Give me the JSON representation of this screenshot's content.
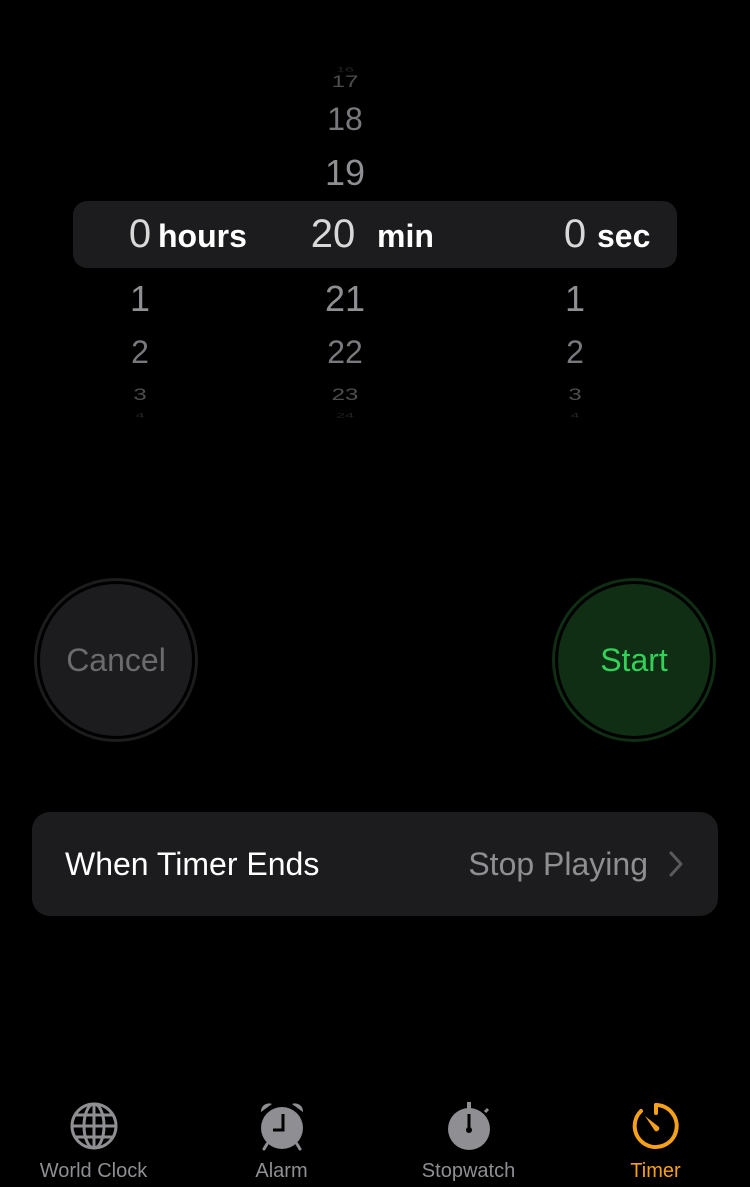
{
  "picker": {
    "hours": {
      "above": [],
      "selected": "0",
      "unit": "hours",
      "below": [
        "1",
        "2",
        "3",
        "4"
      ]
    },
    "minutes": {
      "above": [
        "16",
        "17",
        "18",
        "19"
      ],
      "selected": "20",
      "unit": "min",
      "below": [
        "21",
        "22",
        "23",
        "24"
      ]
    },
    "seconds": {
      "above": [],
      "selected": "0",
      "unit": "sec",
      "below": [
        "1",
        "2",
        "3",
        "4"
      ]
    }
  },
  "buttons": {
    "cancel_label": "Cancel",
    "start_label": "Start"
  },
  "timer_end": {
    "label": "When Timer Ends",
    "value": "Stop Playing"
  },
  "tabbar": {
    "items": [
      {
        "label": "World Clock",
        "icon": "globe-icon",
        "active": false
      },
      {
        "label": "Alarm",
        "icon": "alarm-clock-icon",
        "active": false
      },
      {
        "label": "Stopwatch",
        "icon": "stopwatch-icon",
        "active": false
      },
      {
        "label": "Timer",
        "icon": "timer-icon",
        "active": true
      }
    ]
  },
  "colors": {
    "accent": "#f7a11b",
    "start_green": "#32d158",
    "start_bg": "#0f2e14",
    "inactive": "#8e8e93"
  }
}
